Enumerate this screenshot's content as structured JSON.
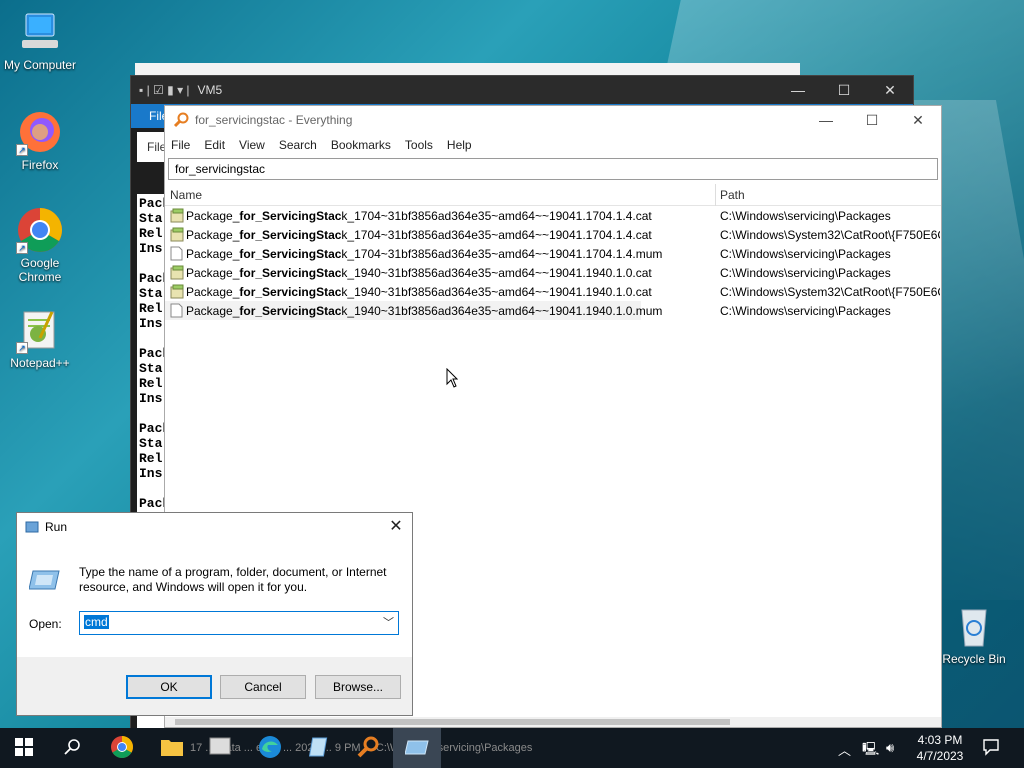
{
  "desktop": {
    "icons": [
      {
        "label": "My Computer"
      },
      {
        "label": "Firefox"
      },
      {
        "label": "Google Chrome"
      },
      {
        "label": "Notepad++"
      },
      {
        "label": "Recycle Bin"
      }
    ]
  },
  "back_window": {
    "title": "VM5",
    "ribbon_tab": "File",
    "addr_stub": "File",
    "cmd_lines": "Pack\nSta\nRel\nIns\n\nPack\nSta\nRel\nIns\n\nPack\nSta\nRel\nIns\n\nPack\nSta\nRel\nIns\n\nPack"
  },
  "everything": {
    "title": "for_servicingstac - Everything",
    "menu": [
      "File",
      "Edit",
      "View",
      "Search",
      "Bookmarks",
      "Tools",
      "Help"
    ],
    "search_value": "for_servicingstac",
    "columns": {
      "name": "Name",
      "path": "Path"
    },
    "rows": [
      {
        "name_pre": "Package_",
        "name_bold": "for_ServicingStac",
        "name_post": "k_1704~31bf3856ad364e35~amd64~~19041.1704.1.4.cat",
        "path": "C:\\Windows\\servicing\\Packages",
        "icon": "cat"
      },
      {
        "name_pre": "Package_",
        "name_bold": "for_ServicingStac",
        "name_post": "k_1704~31bf3856ad364e35~amd64~~19041.1704.1.4.cat",
        "path": "C:\\Windows\\System32\\CatRoot\\{F750E6C",
        "icon": "cat"
      },
      {
        "name_pre": "Package_",
        "name_bold": "for_ServicingStac",
        "name_post": "k_1704~31bf3856ad364e35~amd64~~19041.1704.1.4.mum",
        "path": "C:\\Windows\\servicing\\Packages",
        "icon": "file"
      },
      {
        "name_pre": "Package_",
        "name_bold": "for_ServicingStac",
        "name_post": "k_1940~31bf3856ad364e35~amd64~~19041.1940.1.0.cat",
        "path": "C:\\Windows\\servicing\\Packages",
        "icon": "cat"
      },
      {
        "name_pre": "Package_",
        "name_bold": "for_ServicingStac",
        "name_post": "k_1940~31bf3856ad364e35~amd64~~19041.1940.1.0.cat",
        "path": "C:\\Windows\\System32\\CatRoot\\{F750E6C",
        "icon": "cat"
      },
      {
        "name_pre": "Package_",
        "name_bold": "for_ServicingStac",
        "name_post": "k_1940~31bf3856ad364e35~amd64~~19041.1940.1.0.mum",
        "path": "C:\\Windows\\servicing\\Packages",
        "icon": "file"
      }
    ]
  },
  "run_dialog": {
    "title": "Run",
    "description": "Type the name of a program, folder, document, or Internet resource, and Windows will open it for you.",
    "open_label": "Open:",
    "open_value": "cmd",
    "ok_label": "OK",
    "cancel_label": "Cancel",
    "browse_label": "Browse..."
  },
  "taskbar": {
    "ghost_text": "17 ... Data ... eeds ... 2022 ... 9 PM ... C:\\Windows\\servicing\\Packages",
    "time": "4:03 PM",
    "date": "4/7/2023"
  },
  "colors": {
    "accent": "#0078d7",
    "taskbar": "#101820",
    "ribbon": "#1979ca"
  }
}
